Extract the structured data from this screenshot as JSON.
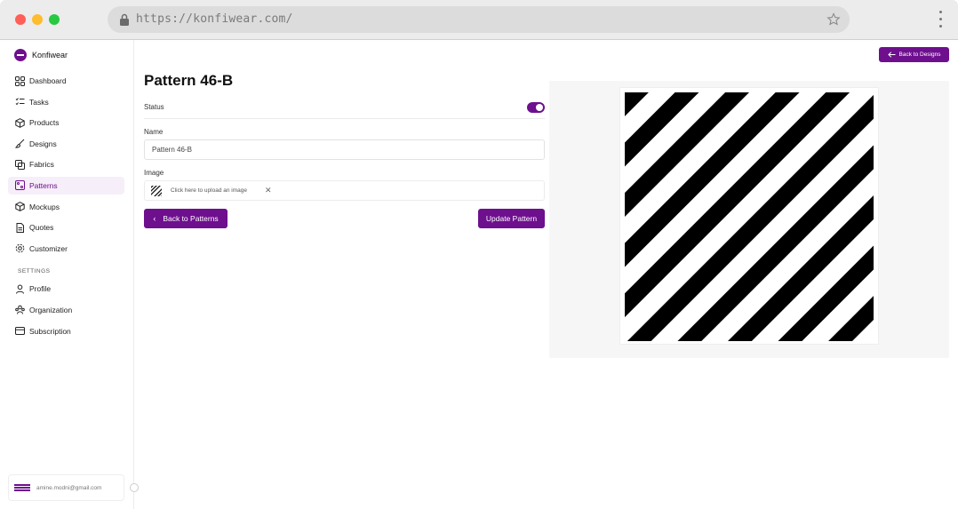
{
  "browser": {
    "url": "https://konfiwear.com/"
  },
  "sidebar": {
    "brand": "Konfiwear",
    "items": [
      {
        "label": "Dashboard",
        "icon": "grid-icon"
      },
      {
        "label": "Tasks",
        "icon": "tasks-icon"
      },
      {
        "label": "Products",
        "icon": "box-icon"
      },
      {
        "label": "Designs",
        "icon": "brush-icon"
      },
      {
        "label": "Fabrics",
        "icon": "layers-icon"
      },
      {
        "label": "Patterns",
        "icon": "pattern-icon",
        "active": true
      },
      {
        "label": "Mockups",
        "icon": "cube-icon"
      },
      {
        "label": "Quotes",
        "icon": "quote-icon"
      },
      {
        "label": "Customizer",
        "icon": "gear-icon"
      }
    ],
    "settings_title": "SETTINGS",
    "settings_items": [
      {
        "label": "Profile",
        "icon": "user-icon"
      },
      {
        "label": "Organization",
        "icon": "organization-icon"
      },
      {
        "label": "Subscription",
        "icon": "card-icon"
      }
    ],
    "user_email": "amine.modni@gmail.com"
  },
  "header": {
    "back_designs_label": "Back to Designs"
  },
  "form": {
    "title": "Pattern 46-B",
    "status_label": "Status",
    "status_on": true,
    "name_label": "Name",
    "name_value": "Pattern 46-B",
    "image_label": "Image",
    "upload_text": "Click here to upload an image",
    "remove_icon": "close-icon",
    "back_patterns_label": "Back to Patterns",
    "update_label": "Update Pattern"
  },
  "colors": {
    "accent": "#6e0f8e",
    "pattern_stripe": "#000000",
    "pattern_bg": "#ffffff"
  }
}
